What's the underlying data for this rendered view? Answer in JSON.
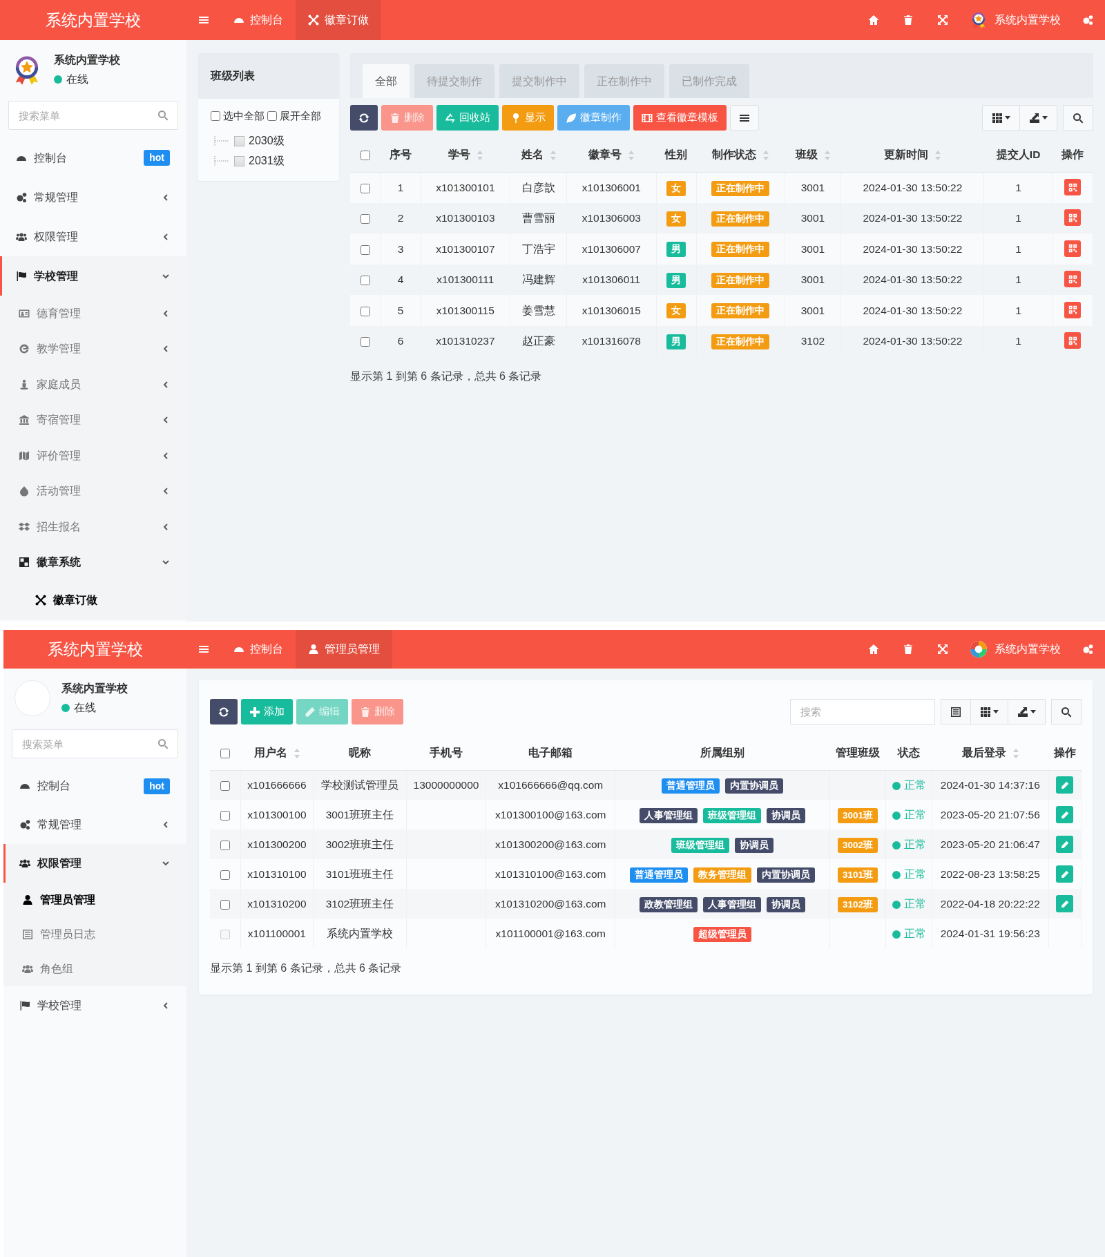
{
  "badge_order_page": {
    "header": {
      "brand": "系统内置学校",
      "tabs": [
        {
          "label": "控制台",
          "selected": false
        },
        {
          "label": "徽章订做",
          "selected": true
        }
      ],
      "user_name": "系统内置学校"
    },
    "sidebar": {
      "user_name": "系统内置学校",
      "online": true,
      "status": "在线",
      "search_placeholder": "搜索菜单",
      "items": [
        {
          "label": "控制台",
          "badge": "hot",
          "selected": false
        },
        {
          "label": "常规管理",
          "expanded": false,
          "selected": false
        },
        {
          "label": "权限管理",
          "expanded": false,
          "selected": false
        },
        {
          "label": "学校管理",
          "expanded": true,
          "selected": false,
          "children": [
            {
              "label": "德育管理",
              "expanded": false,
              "selected": false
            },
            {
              "label": "教学管理",
              "expanded": false,
              "selected": false
            },
            {
              "label": "家庭成员",
              "expanded": false,
              "selected": false
            },
            {
              "label": "寄宿管理",
              "expanded": false,
              "selected": false
            },
            {
              "label": "评价管理",
              "expanded": false,
              "selected": false
            },
            {
              "label": "活动管理",
              "expanded": false,
              "selected": false
            },
            {
              "label": "招生报名",
              "expanded": false,
              "selected": false
            },
            {
              "label": "徽章系统",
              "expanded": true,
              "selected": false,
              "children": [
                {
                  "label": "徽章订做",
                  "selected": true
                }
              ]
            }
          ]
        }
      ]
    },
    "class_tree": {
      "title": "班级列表",
      "options": [
        {
          "label": "选中全部",
          "checked": false
        },
        {
          "label": "展开全部",
          "checked": false
        }
      ],
      "nodes": [
        {
          "label": "2030级",
          "checked": false
        },
        {
          "label": "2031级",
          "checked": false
        }
      ]
    },
    "tabs": [
      {
        "label": "全部",
        "selected": true
      },
      {
        "label": "待提交制作",
        "selected": false
      },
      {
        "label": "提交制作中",
        "selected": false
      },
      {
        "label": "正在制作中",
        "selected": false
      },
      {
        "label": "已制作完成",
        "selected": false
      }
    ],
    "toolbar": [
      {
        "color": "#444c69",
        "disabled": false
      },
      {
        "label": "删除",
        "color": "#f9958a",
        "disabled": true
      },
      {
        "label": "回收站",
        "color": "#18bc9c",
        "disabled": false
      },
      {
        "label": "显示",
        "color": "#f39c12",
        "disabled": false
      },
      {
        "label": "徽章制作",
        "color": "#5aaef0",
        "disabled": false
      },
      {
        "label": "查看徽章模板",
        "color": "#f75444",
        "disabled": false
      },
      {
        "color": "#f8f9fa",
        "disabled": false
      }
    ],
    "table": {
      "all_checked": false,
      "columns": [
        {
          "label": "序号",
          "sortable": false
        },
        {
          "label": "学号",
          "sortable": true
        },
        {
          "label": "姓名",
          "sortable": true
        },
        {
          "label": "徽章号",
          "sortable": true
        },
        {
          "label": "性别",
          "sortable": false
        },
        {
          "label": "制作状态",
          "sortable": true
        },
        {
          "label": "班级",
          "sortable": true
        },
        {
          "label": "更新时间",
          "sortable": true
        },
        {
          "label": "提交人ID",
          "sortable": false
        },
        {
          "label": "操作",
          "sortable": false
        }
      ],
      "rows": [
        {
          "checked": false,
          "no": "1",
          "student_id": "x101300101",
          "name": "白彦歆",
          "badge_no": "x101306001",
          "gender": {
            "text": "女",
            "color": "#f39c12"
          },
          "status": {
            "text": "正在制作中",
            "color": "#f39c12"
          },
          "class": "3001",
          "updated": "2024-01-30 13:50:22",
          "submitter_id": "1"
        },
        {
          "checked": false,
          "no": "2",
          "student_id": "x101300103",
          "name": "曹雪丽",
          "badge_no": "x101306003",
          "gender": {
            "text": "女",
            "color": "#f39c12"
          },
          "status": {
            "text": "正在制作中",
            "color": "#f39c12"
          },
          "class": "3001",
          "updated": "2024-01-30 13:50:22",
          "submitter_id": "1"
        },
        {
          "checked": false,
          "no": "3",
          "student_id": "x101300107",
          "name": "丁浩宇",
          "badge_no": "x101306007",
          "gender": {
            "text": "男",
            "color": "#18bc9c"
          },
          "status": {
            "text": "正在制作中",
            "color": "#f39c12"
          },
          "class": "3001",
          "updated": "2024-01-30 13:50:22",
          "submitter_id": "1"
        },
        {
          "checked": false,
          "no": "4",
          "student_id": "x101300111",
          "name": "冯建辉",
          "badge_no": "x101306011",
          "gender": {
            "text": "男",
            "color": "#18bc9c"
          },
          "status": {
            "text": "正在制作中",
            "color": "#f39c12"
          },
          "class": "3001",
          "updated": "2024-01-30 13:50:22",
          "submitter_id": "1"
        },
        {
          "checked": false,
          "no": "5",
          "student_id": "x101300115",
          "name": "姜雪慧",
          "badge_no": "x101306015",
          "gender": {
            "text": "女",
            "color": "#f39c12"
          },
          "status": {
            "text": "正在制作中",
            "color": "#f39c12"
          },
          "class": "3001",
          "updated": "2024-01-30 13:50:22",
          "submitter_id": "1"
        },
        {
          "checked": false,
          "no": "6",
          "student_id": "x101310237",
          "name": "赵正豪",
          "badge_no": "x101316078",
          "gender": {
            "text": "男",
            "color": "#18bc9c"
          },
          "status": {
            "text": "正在制作中",
            "color": "#f39c12"
          },
          "class": "3102",
          "updated": "2024-01-30 13:50:22",
          "submitter_id": "1"
        }
      ]
    },
    "footer": "显示第 1 到第 6 条记录，总共 6 条记录"
  },
  "admin_page": {
    "header": {
      "brand": "系统内置学校",
      "tabs": [
        {
          "label": "控制台",
          "selected": false
        },
        {
          "label": "管理员管理",
          "selected": true
        }
      ],
      "user_name": "系统内置学校"
    },
    "sidebar": {
      "user_name": "系统内置学校",
      "online": true,
      "status": "在线",
      "search_placeholder": "搜索菜单",
      "items": [
        {
          "label": "控制台",
          "badge": "hot",
          "selected": false
        },
        {
          "label": "常规管理",
          "expanded": false,
          "selected": false
        },
        {
          "label": "权限管理",
          "expanded": true,
          "selected": false,
          "children": [
            {
              "label": "管理员管理",
              "selected": true
            },
            {
              "label": "管理员日志",
              "selected": false
            },
            {
              "label": "角色组",
              "selected": false
            }
          ]
        },
        {
          "label": "学校管理",
          "expanded": false,
          "selected": false
        }
      ]
    },
    "toolbar": [
      {
        "color": "#444c69",
        "disabled": false
      },
      {
        "label": "添加",
        "color": "#18bc9c",
        "disabled": false
      },
      {
        "label": "编辑",
        "color": "#74d6c3",
        "disabled": true
      },
      {
        "label": "删除",
        "color": "#f9958a",
        "disabled": true
      }
    ],
    "search": {
      "placeholder": "搜索"
    },
    "table": {
      "all_checked": false,
      "columns": [
        {
          "label": "用户名",
          "sortable": true
        },
        {
          "label": "昵称",
          "sortable": false
        },
        {
          "label": "手机号",
          "sortable": false
        },
        {
          "label": "电子邮箱",
          "sortable": false
        },
        {
          "label": "所属组别",
          "sortable": false
        },
        {
          "label": "管理班级",
          "sortable": false
        },
        {
          "label": "状态",
          "sortable": false
        },
        {
          "label": "最后登录",
          "sortable": true
        },
        {
          "label": "操作",
          "sortable": false
        }
      ],
      "rows": [
        {
          "checked": false,
          "checkbox_disabled": false,
          "username": "x101666666",
          "nickname": "学校测试管理员",
          "phone": "13000000000",
          "email": "x101666666@qq.com",
          "groups": [
            {
              "text": "普通管理员",
              "color": "#1e8ef0"
            },
            {
              "text": "内置协调员",
              "color": "#444c69"
            }
          ],
          "status": {
            "text": "正常",
            "color": "#18bc9c"
          },
          "last_login": "2024-01-30 14:37:16",
          "editable": true
        },
        {
          "checked": false,
          "checkbox_disabled": false,
          "username": "x101300100",
          "nickname": "3001班班主任",
          "email": "x101300100@163.com",
          "groups": [
            {
              "text": "人事管理组",
              "color": "#444c69"
            },
            {
              "text": "班级管理组",
              "color": "#18bc9c"
            },
            {
              "text": "协调员",
              "color": "#444c69"
            }
          ],
          "class": {
            "text": "3001班",
            "color": "#f39c12"
          },
          "status": {
            "text": "正常",
            "color": "#18bc9c"
          },
          "last_login": "2023-05-20 21:07:56",
          "editable": true
        },
        {
          "checked": false,
          "checkbox_disabled": false,
          "username": "x101300200",
          "nickname": "3002班班主任",
          "email": "x101300200@163.com",
          "groups": [
            {
              "text": "班级管理组",
              "color": "#18bc9c"
            },
            {
              "text": "协调员",
              "color": "#444c69"
            }
          ],
          "class": {
            "text": "3002班",
            "color": "#f39c12"
          },
          "status": {
            "text": "正常",
            "color": "#18bc9c"
          },
          "last_login": "2023-05-20 21:06:47",
          "editable": true
        },
        {
          "checked": false,
          "checkbox_disabled": false,
          "username": "x101310100",
          "nickname": "3101班班主任",
          "email": "x101310100@163.com",
          "groups": [
            {
              "text": "普通管理员",
              "color": "#1e8ef0"
            },
            {
              "text": "教务管理组",
              "color": "#f39c12"
            },
            {
              "text": "内置协调员",
              "color": "#444c69"
            }
          ],
          "class": {
            "text": "3101班",
            "color": "#f39c12"
          },
          "status": {
            "text": "正常",
            "color": "#18bc9c"
          },
          "last_login": "2022-08-23 13:58:25",
          "editable": true
        },
        {
          "checked": false,
          "checkbox_disabled": false,
          "username": "x101310200",
          "nickname": "3102班班主任",
          "email": "x101310200@163.com",
          "groups": [
            {
              "text": "政教管理组",
              "color": "#444c69"
            },
            {
              "text": "人事管理组",
              "color": "#444c69"
            },
            {
              "text": "协调员",
              "color": "#444c69"
            }
          ],
          "class": {
            "text": "3102班",
            "color": "#f39c12"
          },
          "status": {
            "text": "正常",
            "color": "#18bc9c"
          },
          "last_login": "2022-04-18 20:22:22",
          "editable": true
        },
        {
          "checked": false,
          "checkbox_disabled": true,
          "username": "x101100001",
          "nickname": "系统内置学校",
          "email": "x101100001@163.com",
          "groups": [
            {
              "text": "超级管理员",
              "color": "#f75444"
            }
          ],
          "status": {
            "text": "正常",
            "color": "#18bc9c"
          },
          "last_login": "2024-01-31 19:56:23",
          "editable": false
        }
      ]
    },
    "footer": "显示第 1 到第 6 条记录，总共 6 条记录"
  }
}
